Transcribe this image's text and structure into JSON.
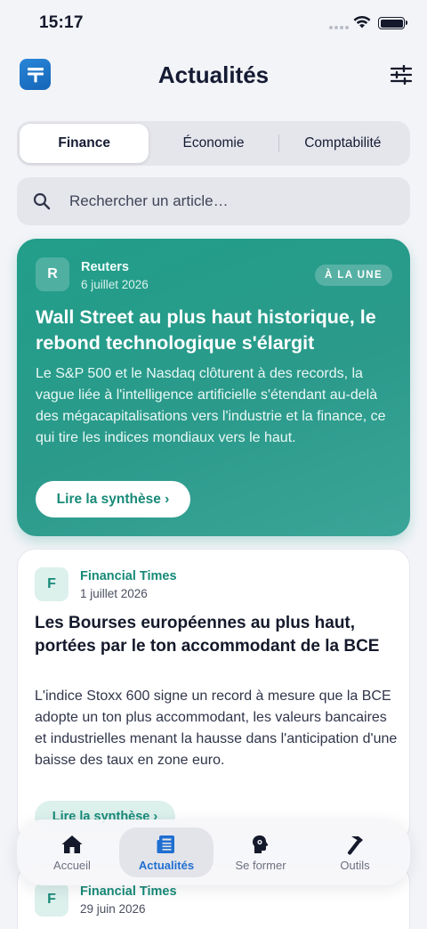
{
  "status_bar": {
    "time": "15:17"
  },
  "header": {
    "title": "Actualités",
    "logo_letter": "T"
  },
  "segments": [
    {
      "label": "Finance",
      "active": true
    },
    {
      "label": "Économie",
      "active": false
    },
    {
      "label": "Comptabilité",
      "active": false
    }
  ],
  "search": {
    "placeholder": "Rechercher un article…"
  },
  "featured": {
    "avatar_letter": "R",
    "source": "Reuters",
    "date": "6 juillet 2026",
    "badge": "À LA UNE",
    "title": "Wall Street au plus haut historique, le rebond technologique s'élargit",
    "excerpt": "Le S&P 500 et le Nasdaq clôturent à des records, la vague liée à l'intelligence artificielle s'étendant au-delà des mégacapitalisations vers l'industrie et la finance, ce qui tire les indices mondiaux vers le haut.",
    "cta": "Lire la synthèse ›"
  },
  "articles": [
    {
      "avatar_letter": "F",
      "source": "Financial Times",
      "date": "1 juillet 2026",
      "title": "Les Bourses européennes au plus haut, portées par le ton accommodant de la BCE",
      "excerpt": "L'indice Stoxx 600 signe un record à mesure que la BCE adopte un ton plus accommodant, les valeurs bancaires et industrielles menant la hausse dans l'anticipation d'une baisse des taux en zone euro.",
      "cta": "Lire la synthèse ›"
    },
    {
      "avatar_letter": "F",
      "source": "Financial Times",
      "date": "29 juin 2026"
    }
  ],
  "tabbar": [
    {
      "label": "Accueil",
      "icon": "home-icon",
      "active": false
    },
    {
      "label": "Actualités",
      "icon": "news-icon",
      "active": true
    },
    {
      "label": "Se former",
      "icon": "learn-icon",
      "active": false
    },
    {
      "label": "Outils",
      "icon": "hammer-icon",
      "active": false
    }
  ],
  "colors": {
    "accent": "#219e8a",
    "tab_active": "#1f6fd1",
    "logo": "#1f78cf"
  }
}
